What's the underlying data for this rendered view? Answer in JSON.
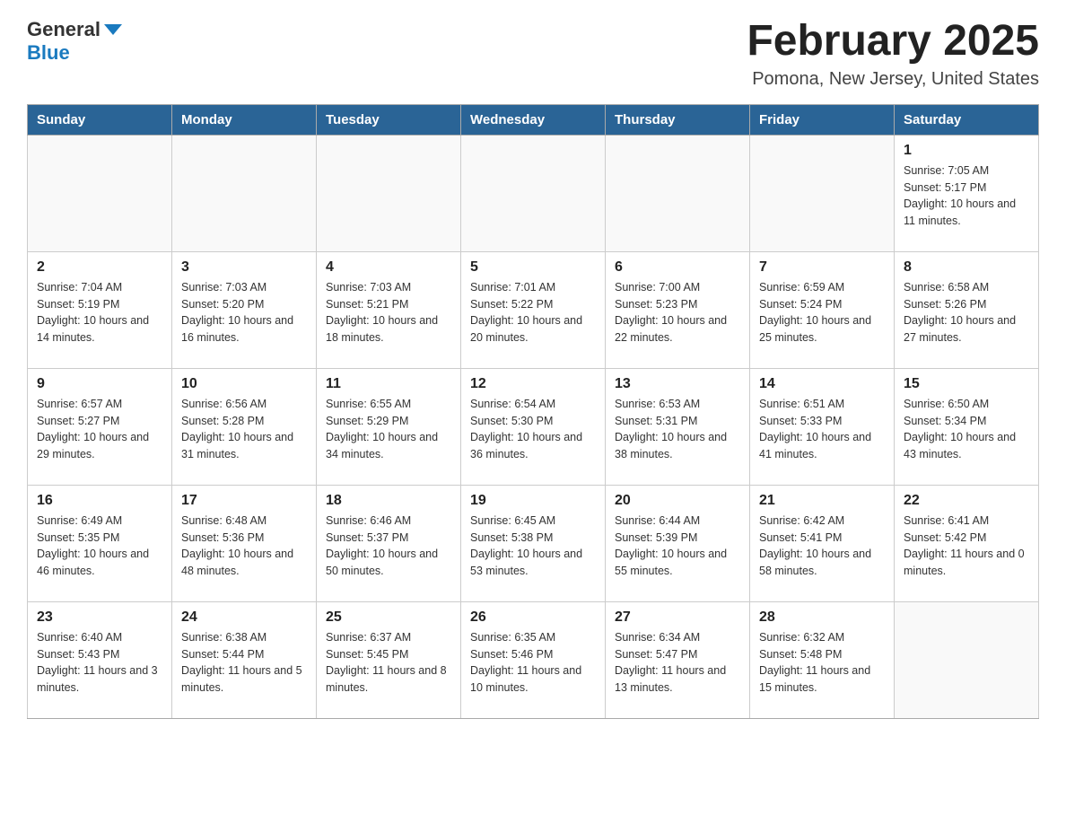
{
  "header": {
    "logo_general": "General",
    "logo_blue": "Blue",
    "calendar_title": "February 2025",
    "calendar_subtitle": "Pomona, New Jersey, United States"
  },
  "days_of_week": [
    "Sunday",
    "Monday",
    "Tuesday",
    "Wednesday",
    "Thursday",
    "Friday",
    "Saturday"
  ],
  "weeks": [
    [
      {
        "day": "",
        "info": ""
      },
      {
        "day": "",
        "info": ""
      },
      {
        "day": "",
        "info": ""
      },
      {
        "day": "",
        "info": ""
      },
      {
        "day": "",
        "info": ""
      },
      {
        "day": "",
        "info": ""
      },
      {
        "day": "1",
        "info": "Sunrise: 7:05 AM\nSunset: 5:17 PM\nDaylight: 10 hours and 11 minutes."
      }
    ],
    [
      {
        "day": "2",
        "info": "Sunrise: 7:04 AM\nSunset: 5:19 PM\nDaylight: 10 hours and 14 minutes."
      },
      {
        "day": "3",
        "info": "Sunrise: 7:03 AM\nSunset: 5:20 PM\nDaylight: 10 hours and 16 minutes."
      },
      {
        "day": "4",
        "info": "Sunrise: 7:03 AM\nSunset: 5:21 PM\nDaylight: 10 hours and 18 minutes."
      },
      {
        "day": "5",
        "info": "Sunrise: 7:01 AM\nSunset: 5:22 PM\nDaylight: 10 hours and 20 minutes."
      },
      {
        "day": "6",
        "info": "Sunrise: 7:00 AM\nSunset: 5:23 PM\nDaylight: 10 hours and 22 minutes."
      },
      {
        "day": "7",
        "info": "Sunrise: 6:59 AM\nSunset: 5:24 PM\nDaylight: 10 hours and 25 minutes."
      },
      {
        "day": "8",
        "info": "Sunrise: 6:58 AM\nSunset: 5:26 PM\nDaylight: 10 hours and 27 minutes."
      }
    ],
    [
      {
        "day": "9",
        "info": "Sunrise: 6:57 AM\nSunset: 5:27 PM\nDaylight: 10 hours and 29 minutes."
      },
      {
        "day": "10",
        "info": "Sunrise: 6:56 AM\nSunset: 5:28 PM\nDaylight: 10 hours and 31 minutes."
      },
      {
        "day": "11",
        "info": "Sunrise: 6:55 AM\nSunset: 5:29 PM\nDaylight: 10 hours and 34 minutes."
      },
      {
        "day": "12",
        "info": "Sunrise: 6:54 AM\nSunset: 5:30 PM\nDaylight: 10 hours and 36 minutes."
      },
      {
        "day": "13",
        "info": "Sunrise: 6:53 AM\nSunset: 5:31 PM\nDaylight: 10 hours and 38 minutes."
      },
      {
        "day": "14",
        "info": "Sunrise: 6:51 AM\nSunset: 5:33 PM\nDaylight: 10 hours and 41 minutes."
      },
      {
        "day": "15",
        "info": "Sunrise: 6:50 AM\nSunset: 5:34 PM\nDaylight: 10 hours and 43 minutes."
      }
    ],
    [
      {
        "day": "16",
        "info": "Sunrise: 6:49 AM\nSunset: 5:35 PM\nDaylight: 10 hours and 46 minutes."
      },
      {
        "day": "17",
        "info": "Sunrise: 6:48 AM\nSunset: 5:36 PM\nDaylight: 10 hours and 48 minutes."
      },
      {
        "day": "18",
        "info": "Sunrise: 6:46 AM\nSunset: 5:37 PM\nDaylight: 10 hours and 50 minutes."
      },
      {
        "day": "19",
        "info": "Sunrise: 6:45 AM\nSunset: 5:38 PM\nDaylight: 10 hours and 53 minutes."
      },
      {
        "day": "20",
        "info": "Sunrise: 6:44 AM\nSunset: 5:39 PM\nDaylight: 10 hours and 55 minutes."
      },
      {
        "day": "21",
        "info": "Sunrise: 6:42 AM\nSunset: 5:41 PM\nDaylight: 10 hours and 58 minutes."
      },
      {
        "day": "22",
        "info": "Sunrise: 6:41 AM\nSunset: 5:42 PM\nDaylight: 11 hours and 0 minutes."
      }
    ],
    [
      {
        "day": "23",
        "info": "Sunrise: 6:40 AM\nSunset: 5:43 PM\nDaylight: 11 hours and 3 minutes."
      },
      {
        "day": "24",
        "info": "Sunrise: 6:38 AM\nSunset: 5:44 PM\nDaylight: 11 hours and 5 minutes."
      },
      {
        "day": "25",
        "info": "Sunrise: 6:37 AM\nSunset: 5:45 PM\nDaylight: 11 hours and 8 minutes."
      },
      {
        "day": "26",
        "info": "Sunrise: 6:35 AM\nSunset: 5:46 PM\nDaylight: 11 hours and 10 minutes."
      },
      {
        "day": "27",
        "info": "Sunrise: 6:34 AM\nSunset: 5:47 PM\nDaylight: 11 hours and 13 minutes."
      },
      {
        "day": "28",
        "info": "Sunrise: 6:32 AM\nSunset: 5:48 PM\nDaylight: 11 hours and 15 minutes."
      },
      {
        "day": "",
        "info": ""
      }
    ]
  ]
}
